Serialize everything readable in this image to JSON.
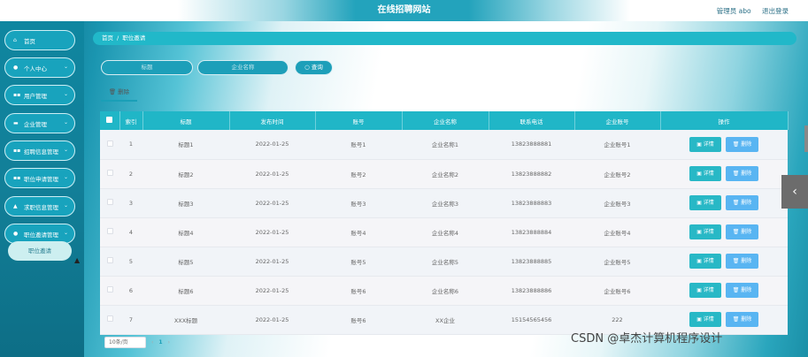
{
  "header": {
    "title": "在线招聘网站",
    "user_label": "管理员 abo",
    "logout_label": "退出登录"
  },
  "sidebar": {
    "items": [
      {
        "icon": "home-icon",
        "label": "首页",
        "has_chevron": false
      },
      {
        "icon": "user-icon",
        "label": "个人中心",
        "has_chevron": true
      },
      {
        "icon": "grid-icon",
        "label": "用户管理",
        "has_chevron": true
      },
      {
        "icon": "monitor-icon",
        "label": "企业管理",
        "has_chevron": true
      },
      {
        "icon": "grid-icon",
        "label": "招聘信息管理",
        "has_chevron": true
      },
      {
        "icon": "grid-icon",
        "label": "职位申请管理",
        "has_chevron": true
      },
      {
        "icon": "thumb-icon",
        "label": "求职信息管理",
        "has_chevron": true
      },
      {
        "icon": "location-icon",
        "label": "职位邀请管理",
        "has_chevron": true
      }
    ],
    "sub_item": "职位邀请"
  },
  "breadcrumb": {
    "home": "首页",
    "separator": "/",
    "current": "职位邀请"
  },
  "search": {
    "title_placeholder": "标题",
    "company_placeholder": "企业名称",
    "button": "查询"
  },
  "toolbar": {
    "delete": "删除"
  },
  "table": {
    "headers": [
      "索引",
      "标题",
      "发布时间",
      "账号",
      "企业名称",
      "联系电话",
      "企业账号",
      "操作"
    ],
    "rows": [
      [
        "1",
        "标题1",
        "2022-01-25",
        "账号1",
        "企业名称1",
        "13823888881",
        "企业账号1"
      ],
      [
        "2",
        "标题2",
        "2022-01-25",
        "账号2",
        "企业名称2",
        "13823888882",
        "企业账号2"
      ],
      [
        "3",
        "标题3",
        "2022-01-25",
        "账号3",
        "企业名称3",
        "13823888883",
        "企业账号3"
      ],
      [
        "4",
        "标题4",
        "2022-01-25",
        "账号4",
        "企业名称4",
        "13823888884",
        "企业账号4"
      ],
      [
        "5",
        "标题5",
        "2022-01-25",
        "账号5",
        "企业名称5",
        "13823888885",
        "企业账号5"
      ],
      [
        "6",
        "标题6",
        "2022-01-25",
        "账号6",
        "企业名称6",
        "13823888886",
        "企业账号6"
      ],
      [
        "7",
        "XXX标题",
        "2022-01-25",
        "账号6",
        "XX企业",
        "15154565456",
        "222"
      ]
    ],
    "detail_label": "详情",
    "delete_label": "删除"
  },
  "pager": {
    "page_size": "10条/页",
    "current_page": "1",
    "prev": "‹",
    "next": "›"
  },
  "watermark": "CSDN @卓杰计算机程序设计",
  "colors": {
    "primary": "#20b6c7",
    "sidebar": "#127f98",
    "delete_button": "#59b5f2"
  }
}
